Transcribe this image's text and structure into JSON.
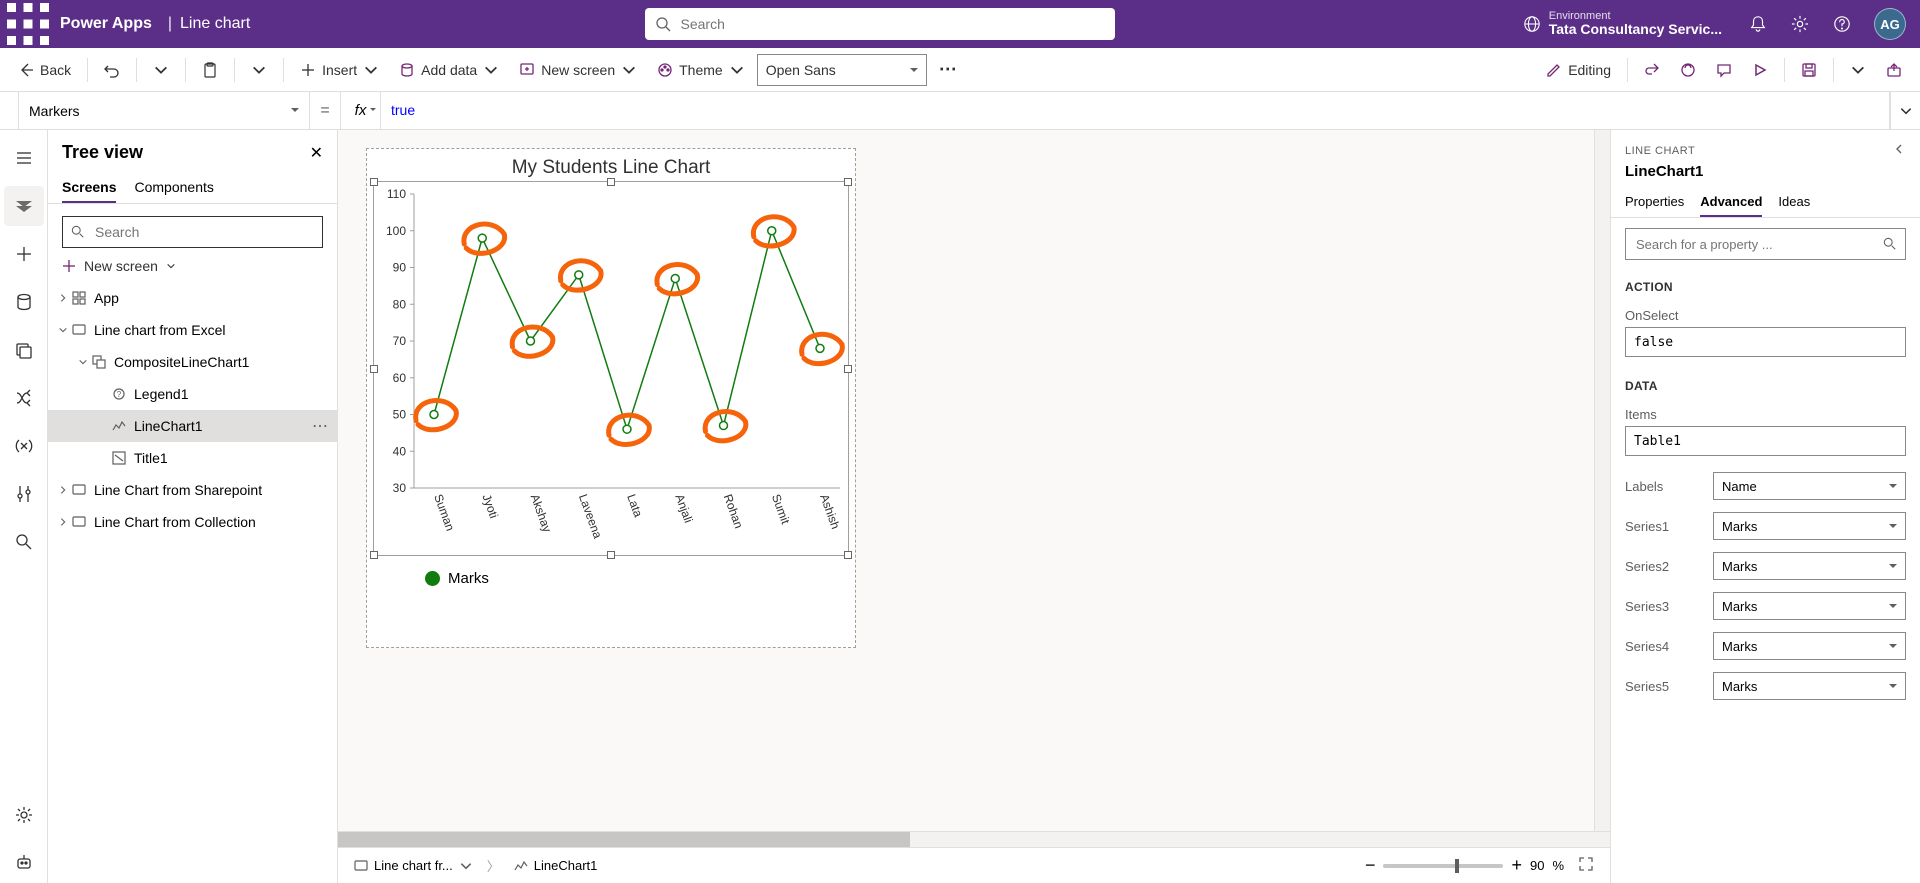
{
  "header": {
    "app_name": "Power Apps",
    "page_name": "Line chart",
    "search_placeholder": "Search",
    "env_label": "Environment",
    "env_value": "Tata Consultancy Servic...",
    "avatar": "AG"
  },
  "cmdbar": {
    "back": "Back",
    "insert": "Insert",
    "add_data": "Add data",
    "new_screen": "New screen",
    "theme": "Theme",
    "font": "Open Sans",
    "editing": "Editing"
  },
  "formula": {
    "property": "Markers",
    "value": "true"
  },
  "tree": {
    "title": "Tree view",
    "tab_screens": "Screens",
    "tab_components": "Components",
    "search_placeholder": "Search",
    "new_screen": "New screen",
    "items": [
      {
        "label": "App",
        "depth": 0,
        "expandable": true,
        "icon": "app"
      },
      {
        "label": "Line chart from Excel",
        "depth": 0,
        "expandable": true,
        "expanded": true,
        "icon": "screen"
      },
      {
        "label": "CompositeLineChart1",
        "depth": 1,
        "expandable": true,
        "expanded": true,
        "icon": "group"
      },
      {
        "label": "Legend1",
        "depth": 2,
        "icon": "legend"
      },
      {
        "label": "LineChart1",
        "depth": 2,
        "icon": "chart",
        "selected": true
      },
      {
        "label": "Title1",
        "depth": 2,
        "icon": "title"
      },
      {
        "label": "Line Chart from Sharepoint",
        "depth": 0,
        "expandable": true,
        "icon": "screen"
      },
      {
        "label": "Line Chart from Collection",
        "depth": 0,
        "expandable": true,
        "icon": "screen"
      }
    ]
  },
  "canvas": {
    "chart_title": "My Students Line Chart",
    "legend_label": "Marks",
    "breadcrumb_screen": "Line chart fr...",
    "breadcrumb_control": "LineChart1",
    "zoom": "90",
    "zoom_unit": "%"
  },
  "prop_panel": {
    "type_label": "LINE CHART",
    "control_name": "LineChart1",
    "tab_properties": "Properties",
    "tab_advanced": "Advanced",
    "tab_ideas": "Ideas",
    "search_placeholder": "Search for a property ...",
    "section_action": "ACTION",
    "label_onselect": "OnSelect",
    "value_onselect": "false",
    "section_data": "DATA",
    "label_items": "Items",
    "value_items": "Table1",
    "rows": [
      {
        "label": "Labels",
        "value": "Name"
      },
      {
        "label": "Series1",
        "value": "Marks"
      },
      {
        "label": "Series2",
        "value": "Marks"
      },
      {
        "label": "Series3",
        "value": "Marks"
      },
      {
        "label": "Series4",
        "value": "Marks"
      },
      {
        "label": "Series5",
        "value": "Marks"
      }
    ]
  },
  "chart_data": {
    "type": "line",
    "title": "My Students Line Chart",
    "xlabel": "",
    "ylabel": "",
    "ylim": [
      30,
      110
    ],
    "y_ticks": [
      30,
      40,
      50,
      60,
      70,
      80,
      90,
      100,
      110
    ],
    "categories": [
      "Suman",
      "Jyoti",
      "Akshay",
      "Laveena",
      "Lata",
      "Anjali",
      "Rohan",
      "Sumit",
      "Ashish"
    ],
    "series": [
      {
        "name": "Marks",
        "values": [
          50,
          98,
          70,
          88,
          46,
          87,
          47,
          100,
          68
        ]
      }
    ],
    "legend": [
      "Marks"
    ]
  }
}
